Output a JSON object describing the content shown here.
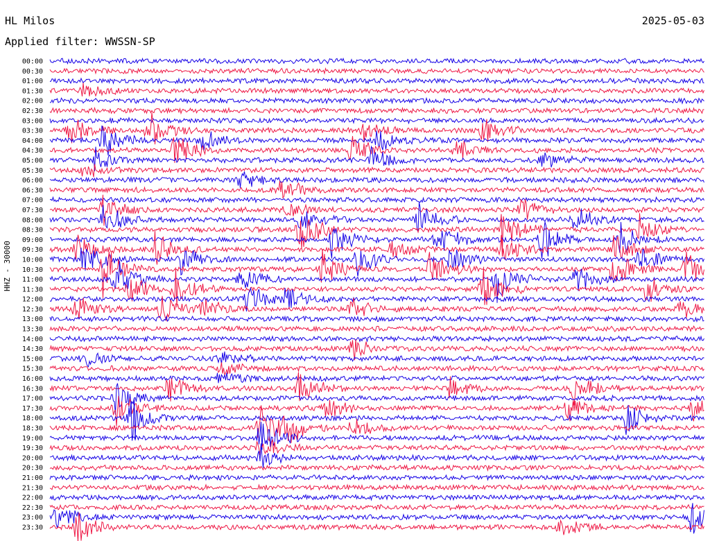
{
  "header": {
    "station": "HL Milos",
    "date": "2025-05-03",
    "filter_label": "Applied filter: WWSSN-SP"
  },
  "colors": {
    "even_line": "#1400e6",
    "odd_line": "#ee1744",
    "background": "#ffffff"
  },
  "chart_data": {
    "type": "line",
    "title": "HL Milos",
    "ylabel": "HHZ - 30000",
    "grid": false,
    "time_labels": [
      "00:00",
      "00:30",
      "01:00",
      "01:30",
      "02:00",
      "02:30",
      "03:00",
      "03:30",
      "04:00",
      "04:30",
      "05:00",
      "05:30",
      "06:00",
      "06:30",
      "07:00",
      "07:30",
      "08:00",
      "08:30",
      "09:00",
      "09:30",
      "10:00",
      "10:30",
      "11:00",
      "11:30",
      "12:00",
      "12:30",
      "13:00",
      "13:30",
      "14:00",
      "14:30",
      "15:00",
      "15:30",
      "16:00",
      "16:30",
      "17:00",
      "17:30",
      "18:00",
      "18:30",
      "19:00",
      "19:30",
      "20:00",
      "20:30",
      "21:00",
      "21:30",
      "22:00",
      "22:30",
      "23:00",
      "23:30"
    ],
    "x_minutes_per_line": 30,
    "events": [
      {
        "trace": 3,
        "at": 0.05,
        "amp": 1.2
      },
      {
        "trace": 7,
        "at": 0.03,
        "amp": 1.8
      },
      {
        "trace": 7,
        "at": 0.15,
        "amp": 2.3
      },
      {
        "trace": 7,
        "at": 0.48,
        "amp": 1.4
      },
      {
        "trace": 7,
        "at": 0.66,
        "amp": 1.9
      },
      {
        "trace": 8,
        "at": 0.08,
        "amp": 2.2
      },
      {
        "trace": 8,
        "at": 0.23,
        "amp": 1.6
      },
      {
        "trace": 8,
        "at": 0.5,
        "amp": 1.3
      },
      {
        "trace": 9,
        "at": 0.19,
        "amp": 2.0
      },
      {
        "trace": 9,
        "at": 0.46,
        "amp": 1.7
      },
      {
        "trace": 9,
        "at": 0.62,
        "amp": 1.4
      },
      {
        "trace": 10,
        "at": 0.07,
        "amp": 1.4
      },
      {
        "trace": 10,
        "at": 0.49,
        "amp": 1.5
      },
      {
        "trace": 10,
        "at": 0.75,
        "amp": 1.2
      },
      {
        "trace": 11,
        "at": 0.05,
        "amp": 1.2
      },
      {
        "trace": 12,
        "at": 0.29,
        "amp": 1.1
      },
      {
        "trace": 13,
        "at": 0.35,
        "amp": 1.5
      },
      {
        "trace": 15,
        "at": 0.08,
        "amp": 2.0
      },
      {
        "trace": 15,
        "at": 0.36,
        "amp": 1.2
      },
      {
        "trace": 15,
        "at": 0.72,
        "amp": 1.4
      },
      {
        "trace": 16,
        "at": 0.08,
        "amp": 2.2
      },
      {
        "trace": 16,
        "at": 0.38,
        "amp": 1.5
      },
      {
        "trace": 16,
        "at": 0.56,
        "amp": 2.0
      },
      {
        "trace": 16,
        "at": 0.8,
        "amp": 1.6
      },
      {
        "trace": 17,
        "at": 0.38,
        "amp": 3.0
      },
      {
        "trace": 17,
        "at": 0.69,
        "amp": 2.6
      },
      {
        "trace": 17,
        "at": 0.9,
        "amp": 1.4
      },
      {
        "trace": 18,
        "at": 0.43,
        "amp": 2.6
      },
      {
        "trace": 18,
        "at": 0.59,
        "amp": 2.2
      },
      {
        "trace": 18,
        "at": 0.75,
        "amp": 2.6
      },
      {
        "trace": 18,
        "at": 0.87,
        "amp": 1.8
      },
      {
        "trace": 19,
        "at": 0.04,
        "amp": 2.0
      },
      {
        "trace": 19,
        "at": 0.16,
        "amp": 2.2
      },
      {
        "trace": 19,
        "at": 0.52,
        "amp": 1.4
      },
      {
        "trace": 19,
        "at": 0.69,
        "amp": 2.0
      },
      {
        "trace": 19,
        "at": 0.86,
        "amp": 1.8
      },
      {
        "trace": 20,
        "at": 0.05,
        "amp": 2.4
      },
      {
        "trace": 20,
        "at": 0.2,
        "amp": 1.8
      },
      {
        "trace": 20,
        "at": 0.47,
        "amp": 2.0
      },
      {
        "trace": 20,
        "at": 0.61,
        "amp": 1.6
      },
      {
        "trace": 20,
        "at": 0.9,
        "amp": 1.8
      },
      {
        "trace": 21,
        "at": 0.08,
        "amp": 2.8
      },
      {
        "trace": 21,
        "at": 0.41,
        "amp": 2.4
      },
      {
        "trace": 21,
        "at": 0.58,
        "amp": 2.0
      },
      {
        "trace": 21,
        "at": 0.86,
        "amp": 2.4
      },
      {
        "trace": 21,
        "at": 0.97,
        "amp": 2.2
      },
      {
        "trace": 22,
        "at": 0.1,
        "amp": 2.6
      },
      {
        "trace": 22,
        "at": 0.29,
        "amp": 2.0
      },
      {
        "trace": 22,
        "at": 0.68,
        "amp": 2.6
      },
      {
        "trace": 22,
        "at": 0.8,
        "amp": 1.8
      },
      {
        "trace": 23,
        "at": 0.12,
        "amp": 2.0
      },
      {
        "trace": 23,
        "at": 0.19,
        "amp": 2.4
      },
      {
        "trace": 23,
        "at": 0.66,
        "amp": 2.4
      },
      {
        "trace": 23,
        "at": 0.91,
        "amp": 1.6
      },
      {
        "trace": 24,
        "at": 0.3,
        "amp": 2.0
      },
      {
        "trace": 24,
        "at": 0.36,
        "amp": 1.6
      },
      {
        "trace": 25,
        "at": 0.04,
        "amp": 1.6
      },
      {
        "trace": 25,
        "at": 0.17,
        "amp": 1.8
      },
      {
        "trace": 25,
        "at": 0.23,
        "amp": 1.4
      },
      {
        "trace": 25,
        "at": 0.46,
        "amp": 1.2
      },
      {
        "trace": 25,
        "at": 0.96,
        "amp": 1.2
      },
      {
        "trace": 29,
        "at": 0.46,
        "amp": 1.4
      },
      {
        "trace": 30,
        "at": 0.05,
        "amp": 1.0
      },
      {
        "trace": 30,
        "at": 0.26,
        "amp": 1.0
      },
      {
        "trace": 31,
        "at": 0.26,
        "amp": 1.0
      },
      {
        "trace": 32,
        "at": 0.26,
        "amp": 1.0
      },
      {
        "trace": 33,
        "at": 0.18,
        "amp": 1.5
      },
      {
        "trace": 33,
        "at": 0.38,
        "amp": 2.4
      },
      {
        "trace": 33,
        "at": 0.61,
        "amp": 1.4
      },
      {
        "trace": 33,
        "at": 0.8,
        "amp": 1.8
      },
      {
        "trace": 34,
        "at": 0.1,
        "amp": 1.8
      },
      {
        "trace": 35,
        "at": 0.1,
        "amp": 2.6
      },
      {
        "trace": 35,
        "at": 0.42,
        "amp": 1.6
      },
      {
        "trace": 35,
        "at": 0.79,
        "amp": 1.4
      },
      {
        "trace": 35,
        "at": 0.98,
        "amp": 1.6
      },
      {
        "trace": 36,
        "at": 0.12,
        "amp": 2.8
      },
      {
        "trace": 36,
        "at": 0.88,
        "amp": 1.8
      },
      {
        "trace": 37,
        "at": 0.32,
        "amp": 3.2
      },
      {
        "trace": 37,
        "at": 0.36,
        "amp": 1.8
      },
      {
        "trace": 37,
        "at": 0.46,
        "amp": 1.4
      },
      {
        "trace": 38,
        "at": 0.32,
        "amp": 2.0
      },
      {
        "trace": 39,
        "at": 0.32,
        "amp": 1.6
      },
      {
        "trace": 40,
        "at": 0.32,
        "amp": 1.4
      },
      {
        "trace": 46,
        "at": 0.01,
        "amp": 1.6
      },
      {
        "trace": 46,
        "at": 0.98,
        "amp": 2.2
      },
      {
        "trace": 47,
        "at": 0.04,
        "amp": 1.8
      },
      {
        "trace": 47,
        "at": 0.78,
        "amp": 1.4
      }
    ]
  }
}
